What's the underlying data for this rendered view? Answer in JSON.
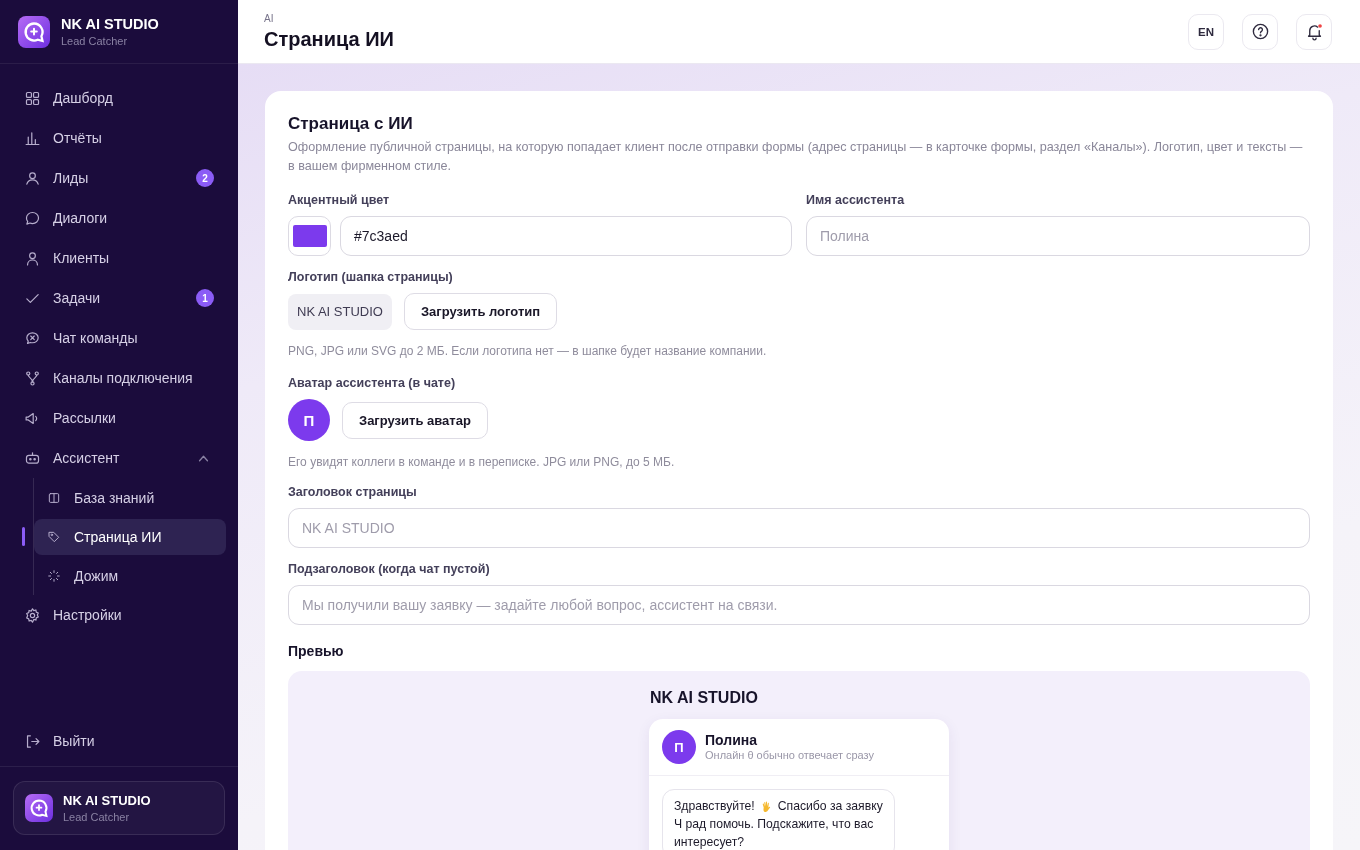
{
  "sidebar": {
    "brand": {
      "title": "NK AI STUDIO",
      "subtitle": "Lead Catcher"
    },
    "nav": [
      {
        "label": "Дашборд",
        "selected": false
      },
      {
        "label": "Отчёты",
        "selected": false
      },
      {
        "label": "Лиды",
        "badge": "2",
        "selected": false
      },
      {
        "label": "Диалоги",
        "selected": false
      },
      {
        "label": "Клиенты",
        "selected": false
      },
      {
        "label": "Задачи",
        "badge": "1",
        "selected": false
      },
      {
        "label": "Чат команды",
        "selected": false
      },
      {
        "label": "Каналы подключения",
        "selected": false
      },
      {
        "label": "Рассылки",
        "selected": false
      },
      {
        "label": "Ассистент",
        "selected": false,
        "expanded": true,
        "children": [
          {
            "label": "База знаний",
            "selected": false
          },
          {
            "label": "Страница ИИ",
            "selected": true
          },
          {
            "label": "Дожим",
            "selected": false
          }
        ]
      },
      {
        "label": "Настройки",
        "selected": false
      }
    ],
    "logout": {
      "label": "Выйти"
    },
    "account": {
      "title": "NK AI STUDIO",
      "subtitle": "Lead Catcher"
    }
  },
  "header": {
    "breadcrumb": "AI",
    "title": "Страница ИИ",
    "language": "EN",
    "notifications": {
      "unread": true
    }
  },
  "card": {
    "title": "Страница с ИИ",
    "description": "Оформление публичной страницы, на которую попадает клиент после отправки формы (адрес страницы — в карточке формы, раздел «Каналы»). Логотип, цвет и тексты — в вашем фирменном стиле.",
    "accent": {
      "label": "Акцентный цвет",
      "color": "#7c3aed",
      "value": "#7c3aed"
    },
    "assistant_name": {
      "label": "Имя ассистента",
      "placeholder": "Полина"
    },
    "logo": {
      "label": "Логотип (шапка страницы)",
      "preview": "NK AI STUDIO",
      "button": "Загрузить логотип",
      "hint": "PNG, JPG или SVG до 2 МБ. Если логотипа нет — в шапке будет название компании."
    },
    "avatar": {
      "label": "Аватар ассистента (в чате)",
      "initial": "П",
      "button": "Загрузить аватар",
      "hint": "Его увидят коллеги в команде и в переписке. JPG или PNG, до 5 МБ."
    },
    "page_title": {
      "label": "Заголовок страницы",
      "placeholder": "NK AI STUDIO"
    },
    "subtitle": {
      "label": "Подзаголовок (когда чат пустой)",
      "placeholder": "Мы получили вашу заявку — задайте любой вопрос, ассистент на связи."
    },
    "preview": {
      "label": "Превью",
      "brand": "NK AI STUDIO",
      "assistant": {
        "initial": "П",
        "name": "Полина",
        "status": "Онлайн θ обычно отвечает сразу"
      },
      "message": {
        "greeting": "Здравствуйте!",
        "thanks": "Спасибо за заявку",
        "text": "Ч рад помочь. Подскажите, что вас интересует?"
      }
    }
  }
}
